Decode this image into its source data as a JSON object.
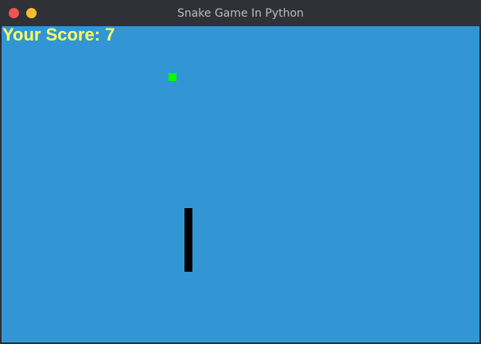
{
  "window": {
    "title": "Snake Game In Python",
    "buttons": {
      "close_color": "#ee5354",
      "minimize_color": "#f4bc2e"
    }
  },
  "game": {
    "score_label": "Your Score: 7",
    "score": 7,
    "background_color": "#3296d4",
    "score_color": "#ffff66",
    "food_color": "#00ff00",
    "snake_color": "#000000"
  }
}
